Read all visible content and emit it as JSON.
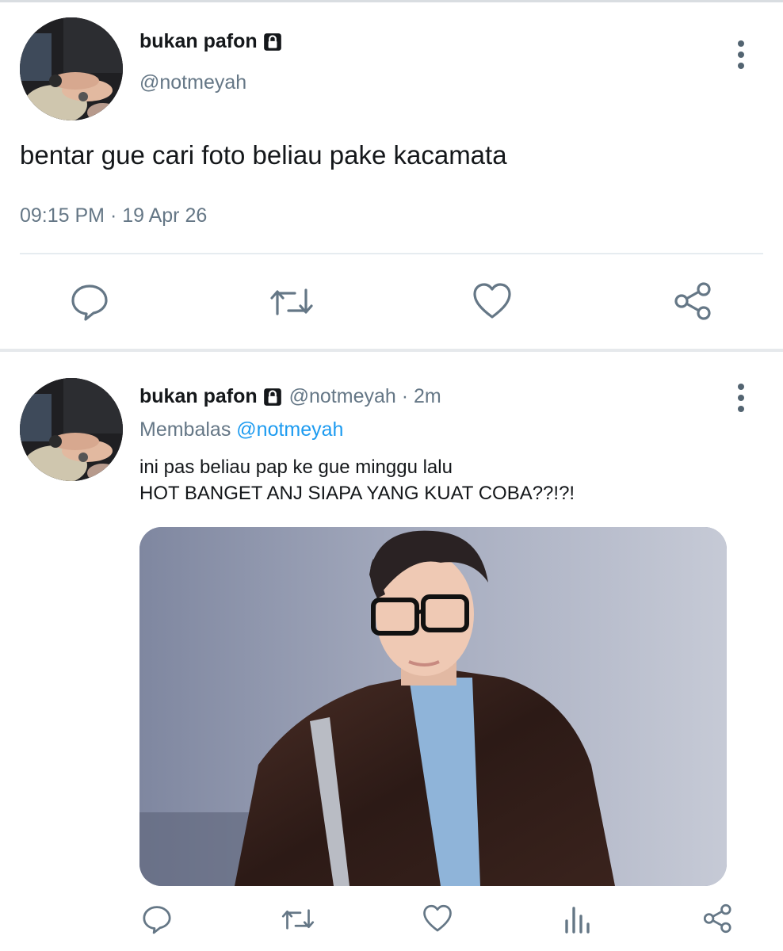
{
  "tweet": {
    "author_name": "bukan pafon",
    "handle": "@notmeyah",
    "text": "bentar gue cari foto beliau pake kacamata",
    "timestamp": "09:15 PM · 19 Apr 26",
    "actions": [
      "reply-icon",
      "retweet-icon",
      "like-icon",
      "share-icon"
    ]
  },
  "reply": {
    "author_name": "bukan pafon",
    "handle_time": "@notmeyah · 2m",
    "replying_label": "Membalas",
    "replying_to": "@notmeyah",
    "text_line1": "ini pas beliau pap ke gue minggu lalu",
    "text_line2": "HOT BANGET ANJ SIAPA YANG KUAT COBA??!?!",
    "actions": [
      "reply-icon",
      "retweet-icon",
      "like-icon",
      "analytics-icon",
      "share-icon"
    ]
  },
  "colors": {
    "text": "#14171a",
    "muted": "#657786",
    "link": "#1d9bf0",
    "icon": "#657786"
  }
}
